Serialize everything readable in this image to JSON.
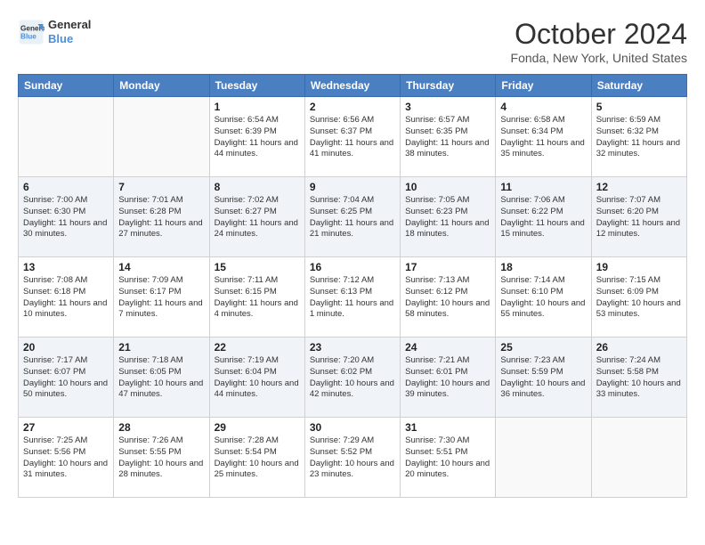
{
  "header": {
    "logo_line1": "General",
    "logo_line2": "Blue",
    "month": "October 2024",
    "location": "Fonda, New York, United States"
  },
  "weekdays": [
    "Sunday",
    "Monday",
    "Tuesday",
    "Wednesday",
    "Thursday",
    "Friday",
    "Saturday"
  ],
  "weeks": [
    [
      {
        "day": "",
        "info": ""
      },
      {
        "day": "",
        "info": ""
      },
      {
        "day": "1",
        "info": "Sunrise: 6:54 AM\nSunset: 6:39 PM\nDaylight: 11 hours and 44 minutes."
      },
      {
        "day": "2",
        "info": "Sunrise: 6:56 AM\nSunset: 6:37 PM\nDaylight: 11 hours and 41 minutes."
      },
      {
        "day": "3",
        "info": "Sunrise: 6:57 AM\nSunset: 6:35 PM\nDaylight: 11 hours and 38 minutes."
      },
      {
        "day": "4",
        "info": "Sunrise: 6:58 AM\nSunset: 6:34 PM\nDaylight: 11 hours and 35 minutes."
      },
      {
        "day": "5",
        "info": "Sunrise: 6:59 AM\nSunset: 6:32 PM\nDaylight: 11 hours and 32 minutes."
      }
    ],
    [
      {
        "day": "6",
        "info": "Sunrise: 7:00 AM\nSunset: 6:30 PM\nDaylight: 11 hours and 30 minutes."
      },
      {
        "day": "7",
        "info": "Sunrise: 7:01 AM\nSunset: 6:28 PM\nDaylight: 11 hours and 27 minutes."
      },
      {
        "day": "8",
        "info": "Sunrise: 7:02 AM\nSunset: 6:27 PM\nDaylight: 11 hours and 24 minutes."
      },
      {
        "day": "9",
        "info": "Sunrise: 7:04 AM\nSunset: 6:25 PM\nDaylight: 11 hours and 21 minutes."
      },
      {
        "day": "10",
        "info": "Sunrise: 7:05 AM\nSunset: 6:23 PM\nDaylight: 11 hours and 18 minutes."
      },
      {
        "day": "11",
        "info": "Sunrise: 7:06 AM\nSunset: 6:22 PM\nDaylight: 11 hours and 15 minutes."
      },
      {
        "day": "12",
        "info": "Sunrise: 7:07 AM\nSunset: 6:20 PM\nDaylight: 11 hours and 12 minutes."
      }
    ],
    [
      {
        "day": "13",
        "info": "Sunrise: 7:08 AM\nSunset: 6:18 PM\nDaylight: 11 hours and 10 minutes."
      },
      {
        "day": "14",
        "info": "Sunrise: 7:09 AM\nSunset: 6:17 PM\nDaylight: 11 hours and 7 minutes."
      },
      {
        "day": "15",
        "info": "Sunrise: 7:11 AM\nSunset: 6:15 PM\nDaylight: 11 hours and 4 minutes."
      },
      {
        "day": "16",
        "info": "Sunrise: 7:12 AM\nSunset: 6:13 PM\nDaylight: 11 hours and 1 minute."
      },
      {
        "day": "17",
        "info": "Sunrise: 7:13 AM\nSunset: 6:12 PM\nDaylight: 10 hours and 58 minutes."
      },
      {
        "day": "18",
        "info": "Sunrise: 7:14 AM\nSunset: 6:10 PM\nDaylight: 10 hours and 55 minutes."
      },
      {
        "day": "19",
        "info": "Sunrise: 7:15 AM\nSunset: 6:09 PM\nDaylight: 10 hours and 53 minutes."
      }
    ],
    [
      {
        "day": "20",
        "info": "Sunrise: 7:17 AM\nSunset: 6:07 PM\nDaylight: 10 hours and 50 minutes."
      },
      {
        "day": "21",
        "info": "Sunrise: 7:18 AM\nSunset: 6:05 PM\nDaylight: 10 hours and 47 minutes."
      },
      {
        "day": "22",
        "info": "Sunrise: 7:19 AM\nSunset: 6:04 PM\nDaylight: 10 hours and 44 minutes."
      },
      {
        "day": "23",
        "info": "Sunrise: 7:20 AM\nSunset: 6:02 PM\nDaylight: 10 hours and 42 minutes."
      },
      {
        "day": "24",
        "info": "Sunrise: 7:21 AM\nSunset: 6:01 PM\nDaylight: 10 hours and 39 minutes."
      },
      {
        "day": "25",
        "info": "Sunrise: 7:23 AM\nSunset: 5:59 PM\nDaylight: 10 hours and 36 minutes."
      },
      {
        "day": "26",
        "info": "Sunrise: 7:24 AM\nSunset: 5:58 PM\nDaylight: 10 hours and 33 minutes."
      }
    ],
    [
      {
        "day": "27",
        "info": "Sunrise: 7:25 AM\nSunset: 5:56 PM\nDaylight: 10 hours and 31 minutes."
      },
      {
        "day": "28",
        "info": "Sunrise: 7:26 AM\nSunset: 5:55 PM\nDaylight: 10 hours and 28 minutes."
      },
      {
        "day": "29",
        "info": "Sunrise: 7:28 AM\nSunset: 5:54 PM\nDaylight: 10 hours and 25 minutes."
      },
      {
        "day": "30",
        "info": "Sunrise: 7:29 AM\nSunset: 5:52 PM\nDaylight: 10 hours and 23 minutes."
      },
      {
        "day": "31",
        "info": "Sunrise: 7:30 AM\nSunset: 5:51 PM\nDaylight: 10 hours and 20 minutes."
      },
      {
        "day": "",
        "info": ""
      },
      {
        "day": "",
        "info": ""
      }
    ]
  ]
}
